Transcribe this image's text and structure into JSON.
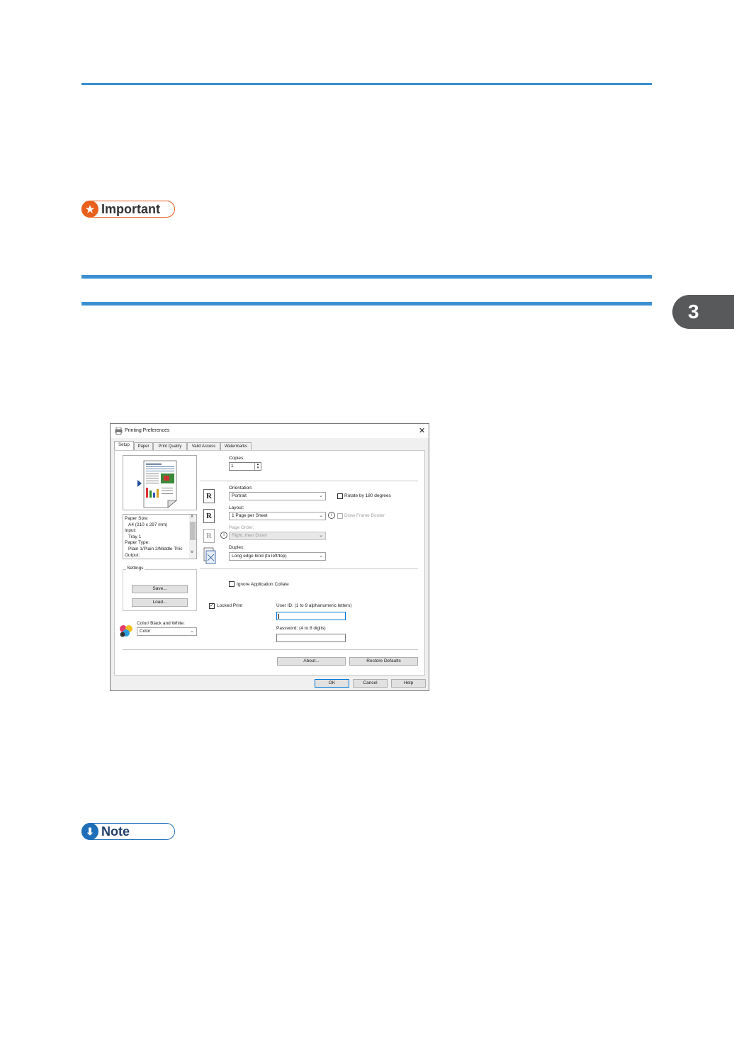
{
  "chapter_tab": "3",
  "badges": {
    "important": "Important",
    "note": "Note"
  },
  "dialog": {
    "title": "Printing Preferences",
    "close_glyph": "✕",
    "tabs": [
      "Setup",
      "Paper",
      "Print Quality",
      "Valid Access",
      "Watermarks"
    ],
    "info_list": [
      "Paper Size:",
      "A4 (210 x 297 mm)",
      "Input:",
      "Tray 1",
      "Paper Type:",
      "Plain 1/Plain 2/Middle Thic",
      "Output:"
    ],
    "settings_group": "Settings",
    "save_button": "Save...",
    "load_button": "Load...",
    "color_label": "Color/ Black and White:",
    "color_value": "Color",
    "copies_label": "Copies:",
    "copies_value": "1",
    "orientation_label": "Orientation:",
    "orientation_value": "Portrait",
    "rotate_label": "Rotate by 180 degrees",
    "layout_label": "Layout:",
    "layout_value": "1 Page per Sheet",
    "frame_border_label": "Draw Frame Border",
    "page_order_label": "Page Order:",
    "page_order_value": "Right, then Down",
    "duplex_label": "Duplex:",
    "duplex_value": "Long edge bind (to left/top)",
    "ignore_collate_label": "Ignore Application Collate",
    "locked_print_label": "Locked Print",
    "user_id_label": "User ID: (1 to 9 alphanumeric letters)",
    "password_label": "Password: (4 to 8 digits)",
    "about_button": "About...",
    "restore_button": "Restore Defaults",
    "ok_button": "OK",
    "cancel_button": "Cancel",
    "help_button": "Help"
  }
}
